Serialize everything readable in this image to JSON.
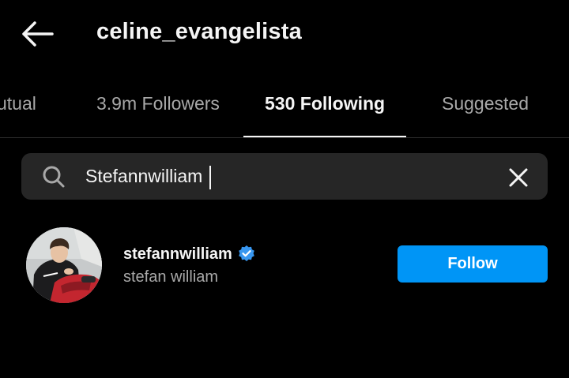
{
  "header": {
    "title": "celine_evangelista",
    "back_icon": "arrow-left-icon"
  },
  "tabs": [
    {
      "label": "utual",
      "active": false
    },
    {
      "label": "3.9m Followers",
      "active": false
    },
    {
      "label": "530 Following",
      "active": true
    },
    {
      "label": "Suggested",
      "active": false
    }
  ],
  "search": {
    "value": "Stefannwilliam",
    "search_icon": "search-icon",
    "clear_icon": "close-icon"
  },
  "result": {
    "username": "stefannwilliam",
    "verified": true,
    "full_name": "stefan william",
    "follow_label": "Follow"
  },
  "colors": {
    "background": "#000000",
    "search_bg": "#262626",
    "primary_text": "#f5f5f5",
    "secondary_text": "#a8a8a8",
    "accent": "#0095f6",
    "verified": "#3897f0"
  }
}
